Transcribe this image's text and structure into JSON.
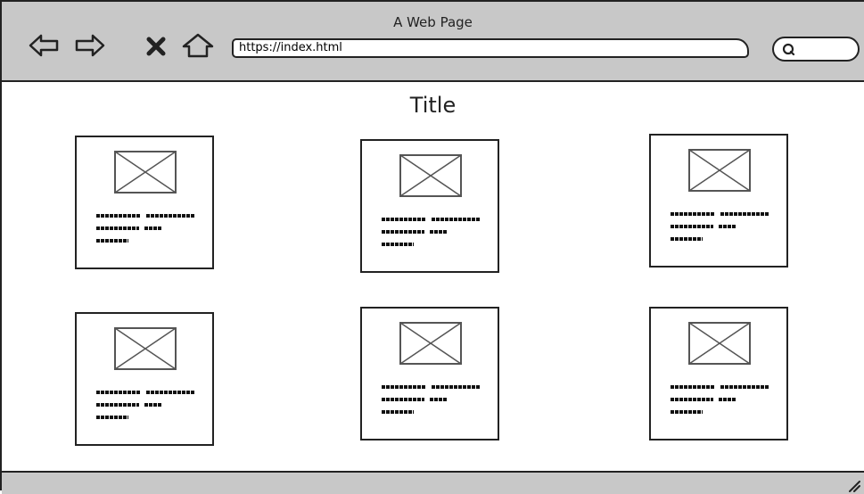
{
  "window": {
    "title": "A Web Page"
  },
  "toolbar": {
    "back_icon": "back-arrow-icon",
    "forward_icon": "forward-arrow-icon",
    "stop_icon": "close-icon",
    "home_icon": "home-icon",
    "url": "https://index.html",
    "search_icon": "search-icon"
  },
  "page": {
    "title": "Title",
    "cards": [
      {
        "image_icon": "image-placeholder-icon"
      },
      {
        "image_icon": "image-placeholder-icon"
      },
      {
        "image_icon": "image-placeholder-icon"
      },
      {
        "image_icon": "image-placeholder-icon"
      },
      {
        "image_icon": "image-placeholder-icon"
      },
      {
        "image_icon": "image-placeholder-icon"
      }
    ]
  },
  "colors": {
    "chrome": "#c8c8c8",
    "ink": "#222222",
    "placeholder": "#555555"
  }
}
